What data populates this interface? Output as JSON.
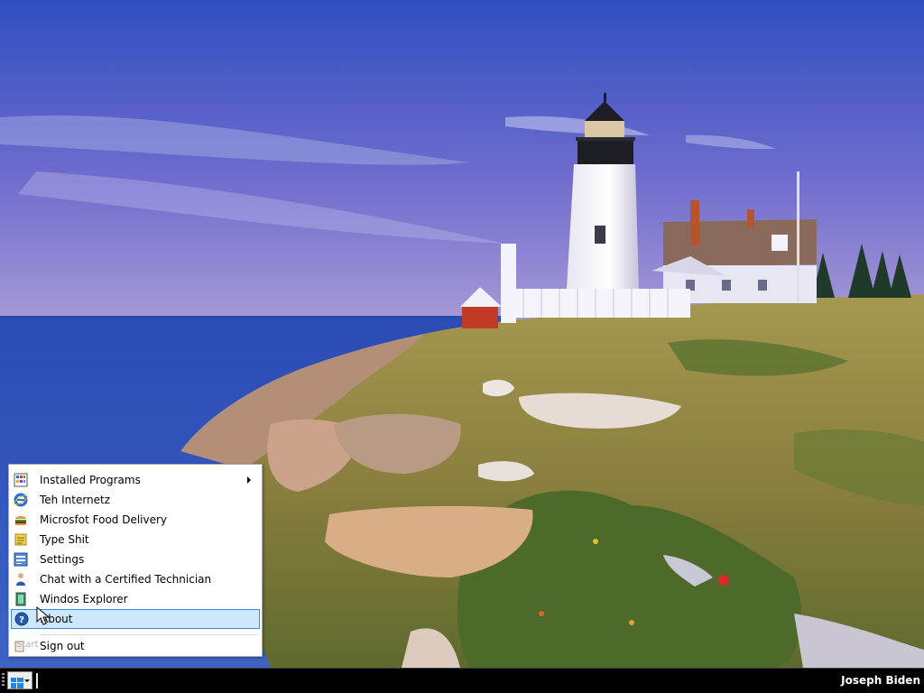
{
  "wallpaper": {
    "scene": "lighthouse-coast",
    "colors": {
      "sky_top": "#3253c2",
      "sky_bottom": "#9a8fd0",
      "sea": "#2a4fb0",
      "grass": "#9a8a4a",
      "rock": "#c9a88a"
    }
  },
  "start_menu": {
    "items": [
      {
        "label": "Installed Programs",
        "icon": "programs-icon",
        "submenu": true
      },
      {
        "label": "Teh Internetz",
        "icon": "internet-explorer-icon"
      },
      {
        "label": "Microsfot Food Delivery",
        "icon": "burger-icon"
      },
      {
        "label": "Type Shit",
        "icon": "notepad-icon"
      },
      {
        "label": "Settings",
        "icon": "settings-icon"
      },
      {
        "label": "Chat with a Certified Technician",
        "icon": "technician-icon"
      },
      {
        "label": "Windos Explorer",
        "icon": "explorer-icon"
      },
      {
        "label": "About",
        "icon": "help-icon",
        "active": true
      },
      {
        "label": "Sign out",
        "icon": "sign-out-icon"
      }
    ],
    "ghost_label": "Start"
  },
  "taskbar": {
    "user_name": "Joseph Biden",
    "accent": "#1e88e5",
    "highlight_color": "#cde8fa",
    "highlight_border": "#3c8ad8"
  }
}
